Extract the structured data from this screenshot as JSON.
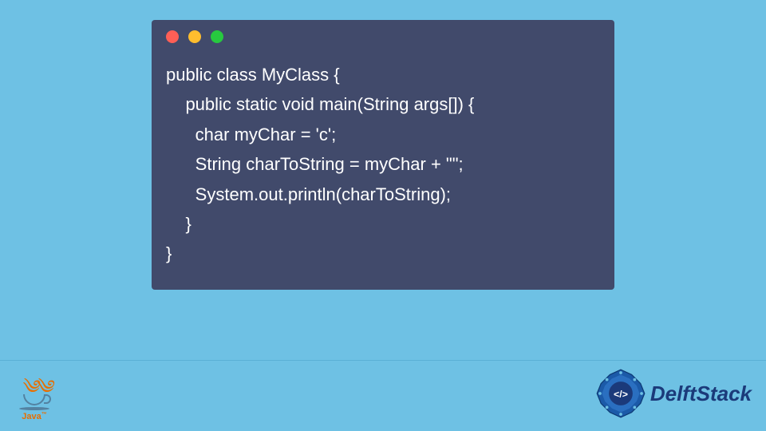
{
  "code": {
    "line1": "public class MyClass {",
    "line2": "    public static void main(String args[]) {",
    "line3": "      char myChar = 'c';",
    "line4": "      String charToString = myChar + \"\";",
    "line5": "      System.out.println(charToString);",
    "line6": "    }",
    "line7": "}"
  },
  "javaLabel": "Java",
  "javaTM": "™",
  "brand": "DelftStack"
}
